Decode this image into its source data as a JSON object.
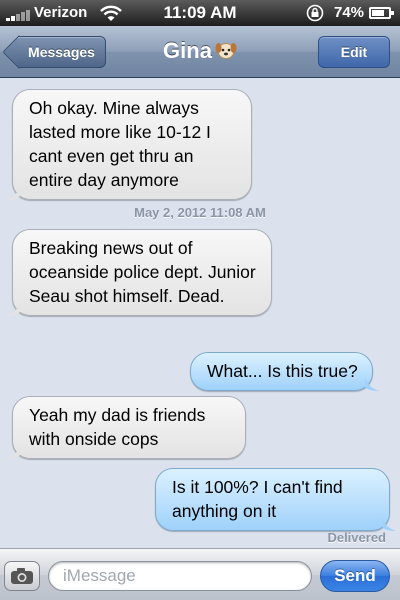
{
  "status_bar": {
    "carrier": "Verizon",
    "time": "11:09 AM",
    "battery_percent": "74%",
    "battery_level": 0.74,
    "signal_icon": "signal-bars-icon",
    "wifi_icon": "wifi-icon",
    "lock_icon": "rotation-lock-icon"
  },
  "nav": {
    "back_label": "Messages",
    "title": "Gina",
    "title_icon": "dog-face-icon",
    "edit_label": "Edit"
  },
  "conversation": {
    "messages": [
      {
        "direction": "incoming",
        "text": "Oh okay. Mine always lasted more like 10-12 I cant even get thru an entire day anymore"
      },
      {
        "direction": "incoming",
        "text": "Breaking news out of oceanside police dept. Junior Seau shot himself. Dead."
      },
      {
        "direction": "outgoing",
        "text": "What... Is this true?"
      },
      {
        "direction": "incoming",
        "text": "Yeah my dad is friends with onside cops"
      },
      {
        "direction": "outgoing",
        "text": "Is it 100%? I can't find anything on it"
      }
    ],
    "timestamp": "May 2, 2012 11:08 AM",
    "delivered_label": "Delivered"
  },
  "input_bar": {
    "placeholder": "iMessage",
    "value": "",
    "send_label": "Send",
    "camera_icon": "camera-icon"
  },
  "colors": {
    "background": "#dbe2ed",
    "outgoing_bubble": "#9fd1fa",
    "incoming_bubble": "#e8e8e8",
    "send_button": "#3a7ee0"
  }
}
